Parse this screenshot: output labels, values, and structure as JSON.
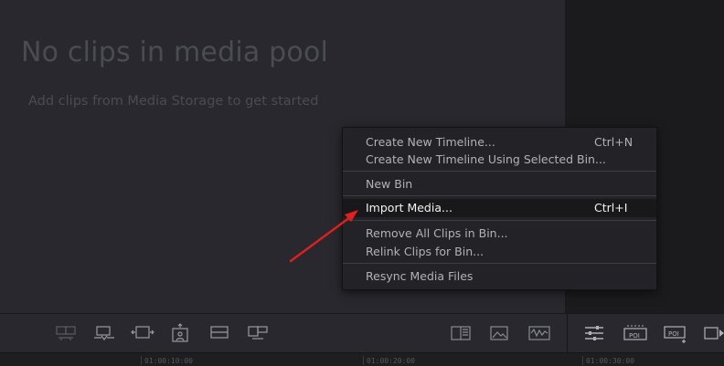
{
  "media_pool": {
    "empty_title": "No clips in media pool",
    "empty_subtitle": "Add clips from Media Storage to get started"
  },
  "context_menu": {
    "items": [
      {
        "label": "Create New Timeline...",
        "shortcut": "Ctrl+N"
      },
      {
        "label": "Create New Timeline Using Selected Bin...",
        "shortcut": ""
      },
      {
        "label": "New Bin",
        "shortcut": ""
      },
      {
        "label": "Import Media...",
        "shortcut": "Ctrl+I",
        "highlighted": true
      },
      {
        "label": "Remove All Clips in Bin...",
        "shortcut": ""
      },
      {
        "label": "Relink Clips for Bin...",
        "shortcut": ""
      },
      {
        "label": "Resync Media Files",
        "shortcut": ""
      }
    ]
  },
  "toolbar": {
    "icons": [
      "dual-clip-view-icon",
      "insert-clip-icon",
      "fit-fill-icon",
      "place-on-top-icon",
      "overwrite-icon",
      "append-icon",
      "metadata-view-icon",
      "image-view-icon",
      "waveform-view-icon",
      "inspector-adjust-icon",
      "poi-icon",
      "add-poi-icon",
      "play-icon"
    ]
  },
  "timeline_ruler": {
    "timecodes": [
      "01:00:10:00",
      "01:00:20:00",
      "01:00:30:00"
    ]
  },
  "annotation": {
    "arrow_color": "#e0201e"
  }
}
